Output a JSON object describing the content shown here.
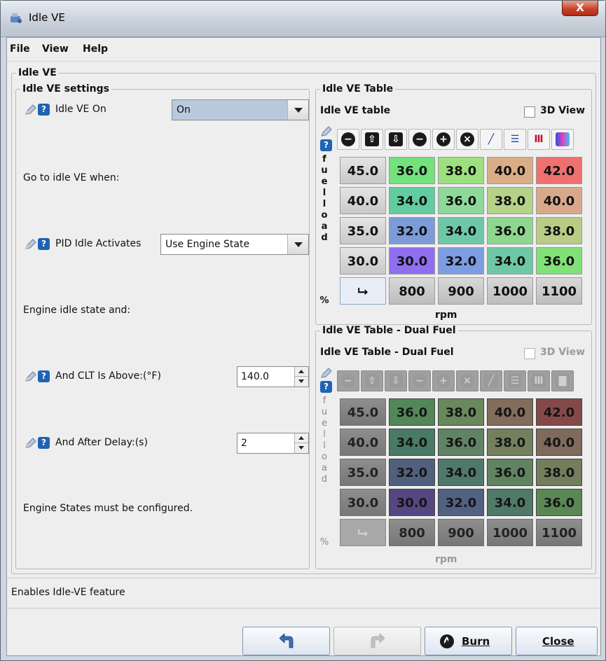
{
  "window": {
    "title": "Idle VE",
    "close_glyph": "X"
  },
  "menu": {
    "file": "File",
    "view": "View",
    "help": "Help"
  },
  "outer_group": {
    "title": "Idle VE"
  },
  "settings": {
    "title": "Idle VE settings",
    "idle_ve_on": {
      "label": "Idle VE On",
      "value": "On"
    },
    "go_to_idle_text": "Go to idle VE when:",
    "pid_idle": {
      "label": "PID Idle Activates",
      "value": "Use Engine State"
    },
    "engine_idle_text": "Engine idle state and:",
    "clt": {
      "label": "And CLT Is Above:(°F)",
      "value": "140.0"
    },
    "delay": {
      "label": "And After Delay:(s)",
      "value": "2"
    },
    "engine_states_text": "Engine States must be configured."
  },
  "table1": {
    "group_title": "Idle VE Table",
    "header": "Idle VE table",
    "view3d": "3D View",
    "y_axis_letters": [
      "f",
      "u",
      "e",
      "l",
      "l",
      "o",
      "a",
      "d"
    ],
    "y_unit": "%",
    "x_unit": "rpm",
    "corner_glyph": "⮡",
    "toolbar_glyphs": [
      "−",
      "⇧",
      "⇩",
      "−",
      "+",
      "×",
      "╱",
      "☰",
      "Ⅲ",
      "▇"
    ],
    "y_values": [
      "45.0",
      "40.0",
      "35.0",
      "30.0"
    ],
    "x_values": [
      "800",
      "900",
      "1000",
      "1100"
    ],
    "rows": [
      [
        "36.0",
        "38.0",
        "40.0",
        "42.0"
      ],
      [
        "34.0",
        "36.0",
        "38.0",
        "40.0"
      ],
      [
        "32.0",
        "34.0",
        "36.0",
        "38.0"
      ],
      [
        "30.0",
        "32.0",
        "34.0",
        "36.0"
      ]
    ]
  },
  "table2": {
    "group_title": "Idle VE Table - Dual Fuel",
    "header": "Idle VE Table - Dual Fuel",
    "view3d": "3D View",
    "y_axis_letters": [
      "f",
      "u",
      "e",
      "l",
      "l",
      "o",
      "a",
      "d"
    ],
    "y_unit": "%",
    "x_unit": "rpm",
    "corner_glyph": "⮡",
    "toolbar_glyphs": [
      "−",
      "⇧",
      "⇩",
      "−",
      "+",
      "×",
      "╱",
      "☰",
      "Ⅲ",
      "▇"
    ],
    "y_values": [
      "45.0",
      "40.0",
      "35.0",
      "30.0"
    ],
    "x_values": [
      "800",
      "900",
      "1000",
      "1100"
    ],
    "rows": [
      [
        "36.0",
        "38.0",
        "40.0",
        "42.0"
      ],
      [
        "34.0",
        "36.0",
        "38.0",
        "40.0"
      ],
      [
        "32.0",
        "34.0",
        "36.0",
        "38.0"
      ],
      [
        "30.0",
        "32.0",
        "34.0",
        "36.0"
      ]
    ]
  },
  "status": {
    "text": "Enables Idle-VE feature"
  },
  "buttons": {
    "burn": "Burn",
    "close": "Close"
  },
  "colors": {
    "cell_colors": [
      [
        "#73e27d",
        "#9ee07f",
        "#d9ae86",
        "#f06f6f"
      ],
      [
        "#62cc9f",
        "#8ed99a",
        "#b5d288",
        "#d7a98a"
      ],
      [
        "#7b9bd9",
        "#6dc8a8",
        "#8dd88e",
        "#b8cc86"
      ],
      [
        "#8f6ff0",
        "#7c9de2",
        "#6ec8a5",
        "#80e276"
      ]
    ],
    "toolbar_row1": [
      "#1a1a1a",
      "#1a1a1a",
      "#1a1a1a",
      "#1a1a1a",
      "#1a1a1a",
      "#1a1a1a"
    ],
    "accent_blue": "#1e64b4"
  },
  "icons": [
    "app-icon",
    "pencil-icon",
    "help-icon",
    "undo-icon",
    "redo-icon",
    "burn-icon"
  ]
}
